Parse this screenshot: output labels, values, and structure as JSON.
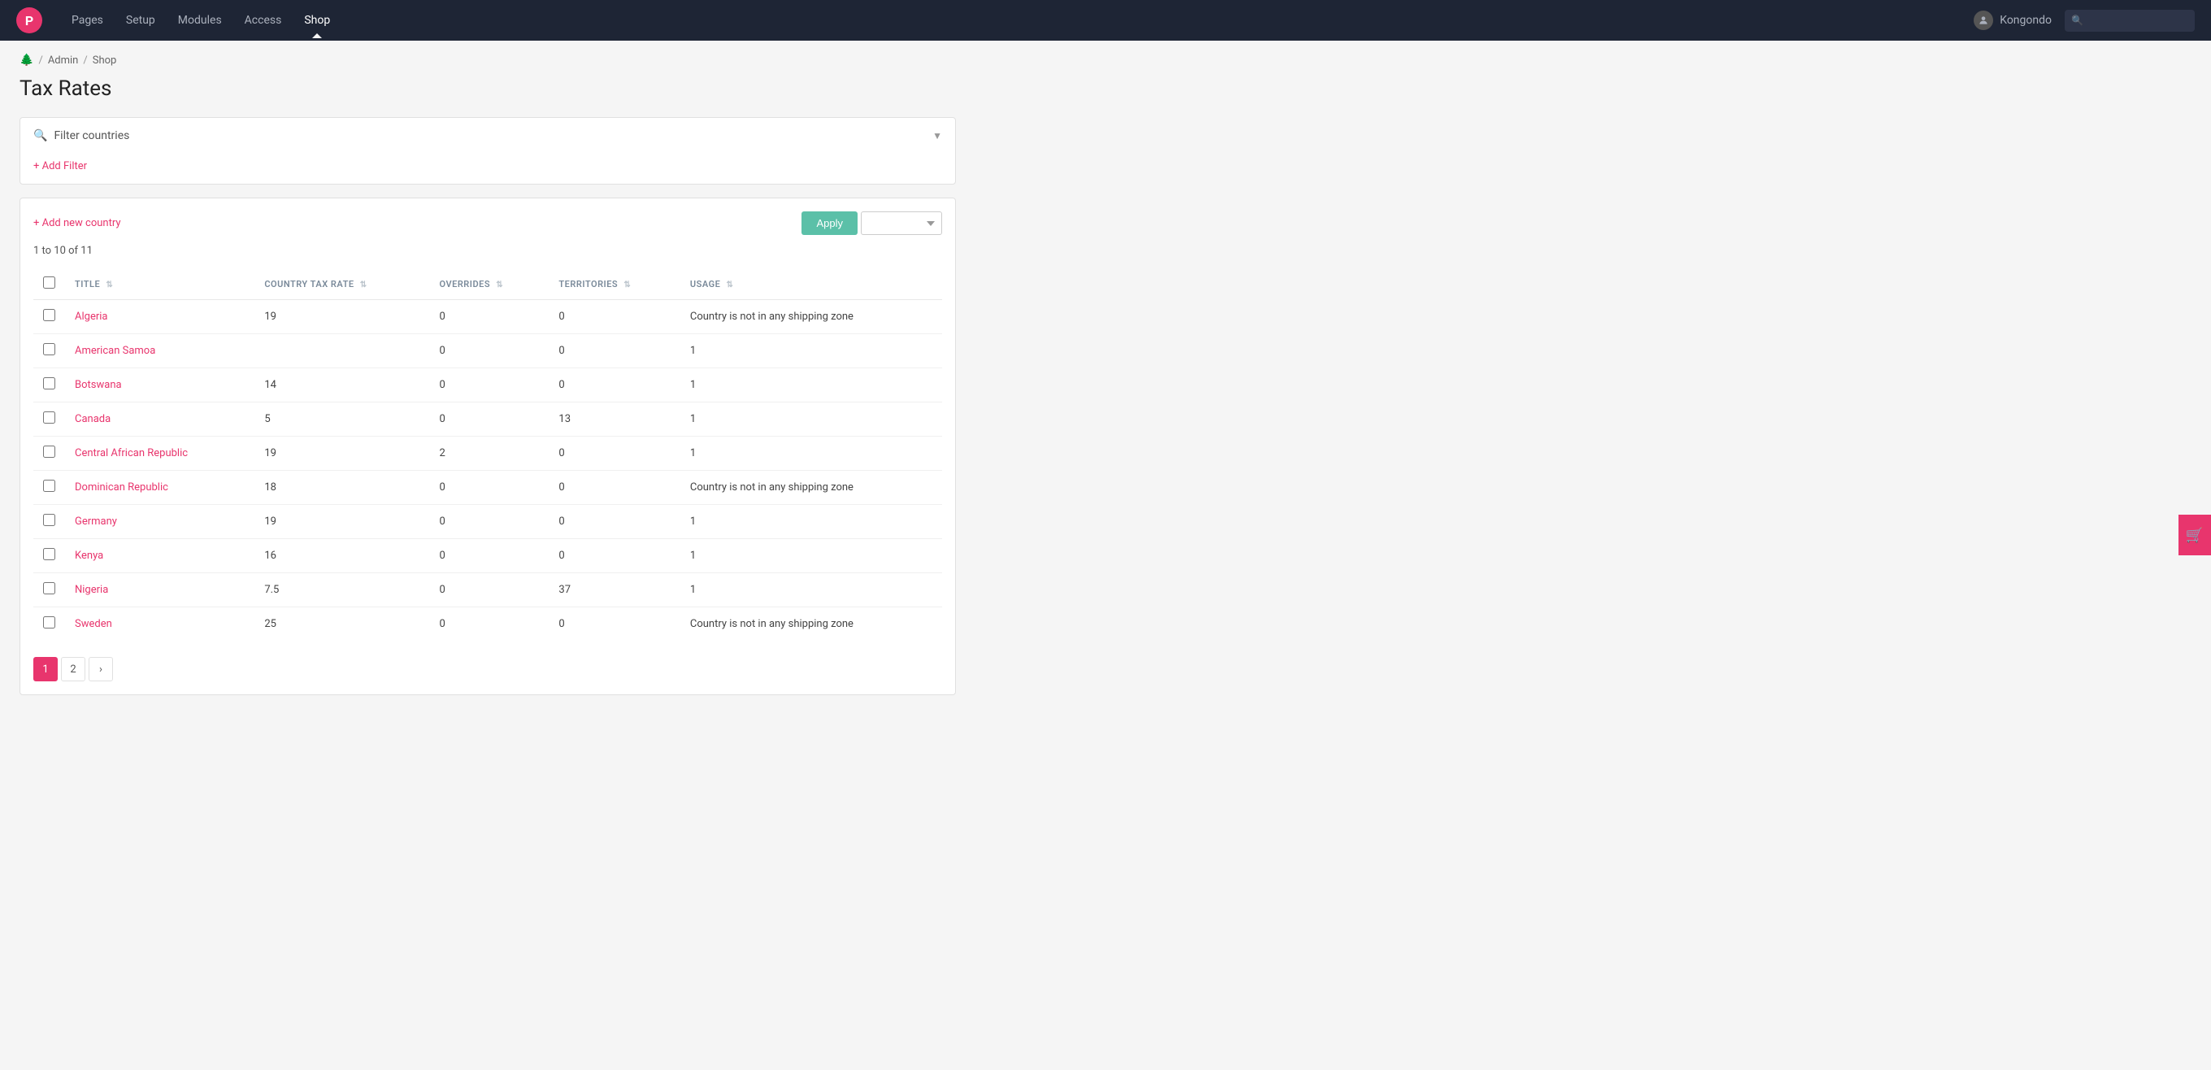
{
  "topnav": {
    "logo_letter": "P",
    "links": [
      {
        "label": "Pages",
        "active": false
      },
      {
        "label": "Setup",
        "active": false
      },
      {
        "label": "Modules",
        "active": false
      },
      {
        "label": "Access",
        "active": false
      },
      {
        "label": "Shop",
        "active": true
      }
    ],
    "user_name": "Kongondo",
    "search_placeholder": ""
  },
  "breadcrumb": {
    "home_icon": "🌲",
    "items": [
      "Admin",
      "Shop"
    ]
  },
  "page": {
    "title": "Tax Rates"
  },
  "filter": {
    "label": "Filter countries",
    "add_filter_label": "+ Add Filter"
  },
  "table": {
    "add_country_label": "+ Add new country",
    "apply_label": "Apply",
    "bulk_select_placeholder": "",
    "pagination_info": "1 to 10 of 11",
    "columns": [
      {
        "key": "title",
        "label": "Title"
      },
      {
        "key": "country_tax_rate",
        "label": "Country Tax Rate"
      },
      {
        "key": "overrides",
        "label": "Overrides"
      },
      {
        "key": "territories",
        "label": "Territories"
      },
      {
        "key": "usage",
        "label": "Usage"
      }
    ],
    "rows": [
      {
        "title": "Algeria",
        "country_tax_rate": "19",
        "overrides": "0",
        "territories": "0",
        "usage": "Country is not in any shipping zone"
      },
      {
        "title": "American Samoa",
        "country_tax_rate": "",
        "overrides": "0",
        "territories": "0",
        "usage": "1"
      },
      {
        "title": "Botswana",
        "country_tax_rate": "14",
        "overrides": "0",
        "territories": "0",
        "usage": "1"
      },
      {
        "title": "Canada",
        "country_tax_rate": "5",
        "overrides": "0",
        "territories": "13",
        "usage": "1"
      },
      {
        "title": "Central African Republic",
        "country_tax_rate": "19",
        "overrides": "2",
        "territories": "0",
        "usage": "1"
      },
      {
        "title": "Dominican Republic",
        "country_tax_rate": "18",
        "overrides": "0",
        "territories": "0",
        "usage": "Country is not in any shipping zone"
      },
      {
        "title": "Germany",
        "country_tax_rate": "19",
        "overrides": "0",
        "territories": "0",
        "usage": "1"
      },
      {
        "title": "Kenya",
        "country_tax_rate": "16",
        "overrides": "0",
        "territories": "0",
        "usage": "1"
      },
      {
        "title": "Nigeria",
        "country_tax_rate": "7.5",
        "overrides": "0",
        "territories": "37",
        "usage": "1"
      },
      {
        "title": "Sweden",
        "country_tax_rate": "25",
        "overrides": "0",
        "territories": "0",
        "usage": "Country is not in any shipping zone"
      }
    ],
    "pagination": {
      "current": 1,
      "pages": [
        "1",
        "2"
      ]
    }
  }
}
